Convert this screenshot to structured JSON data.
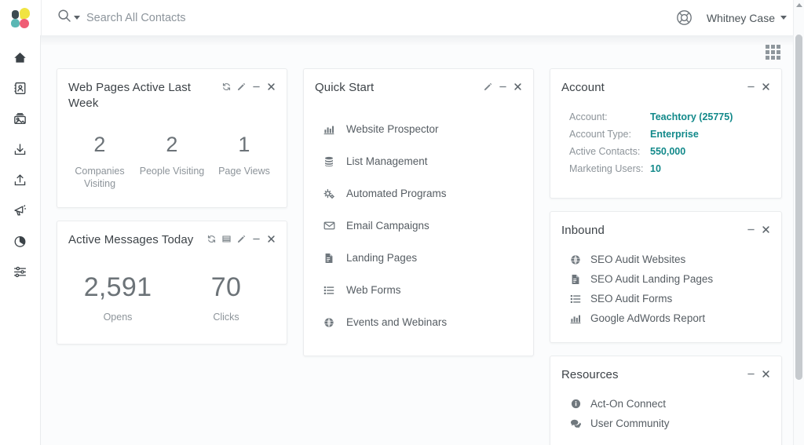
{
  "topbar": {
    "logo_name": "act-on-logo",
    "search": {
      "placeholder": "Search All Contacts",
      "value": "",
      "icon": "search-icon",
      "dropdown_icon": "caret-down-icon"
    },
    "help_icon": "life-ring-help-icon",
    "user": {
      "name": "Whitney Case",
      "caret": "caret-down-icon"
    }
  },
  "sidebar": {
    "items": [
      {
        "icon": "home-icon",
        "label": "Home"
      },
      {
        "icon": "contacts-icon",
        "label": "Contacts"
      },
      {
        "icon": "media-images-icon",
        "label": "Content"
      },
      {
        "icon": "inbound-download-icon",
        "label": "Inbound"
      },
      {
        "icon": "outbound-upload-icon",
        "label": "Outbound"
      },
      {
        "icon": "megaphone-icon",
        "label": "Automated Programs"
      },
      {
        "icon": "pie-chart-icon",
        "label": "Reports"
      },
      {
        "icon": "sliders-settings-icon",
        "label": "Settings"
      }
    ]
  },
  "content": {
    "grid_toggle_icon": "grid-layout-icon"
  },
  "panels": {
    "web_pages": {
      "title": "Web Pages Active Last Week",
      "tools": [
        "refresh-icon",
        "edit-pencil-icon",
        "minimize-icon",
        "close-icon"
      ],
      "stats": [
        {
          "value": "2",
          "label": "Companies Visiting"
        },
        {
          "value": "2",
          "label": "People Visiting"
        },
        {
          "value": "1",
          "label": "Page Views"
        }
      ]
    },
    "active_messages": {
      "title": "Active Messages Today",
      "tools": [
        "refresh-icon",
        "table-view-icon",
        "edit-pencil-icon",
        "minimize-icon",
        "close-icon"
      ],
      "stats": [
        {
          "value": "2,591",
          "label": "Opens"
        },
        {
          "value": "70",
          "label": "Clicks"
        }
      ]
    },
    "quick_start": {
      "title": "Quick Start",
      "tools": [
        "edit-pencil-icon",
        "minimize-icon",
        "close-icon"
      ],
      "items": [
        {
          "icon": "bar-chart-icon",
          "label": "Website Prospector"
        },
        {
          "icon": "database-icon",
          "label": "List Management"
        },
        {
          "icon": "gears-icon",
          "label": "Automated Programs"
        },
        {
          "icon": "envelope-icon",
          "label": "Email Campaigns"
        },
        {
          "icon": "document-icon",
          "label": "Landing Pages"
        },
        {
          "icon": "list-icon",
          "label": "Web Forms"
        },
        {
          "icon": "globe-icon",
          "label": "Events and Webinars"
        }
      ]
    },
    "account": {
      "title": "Account",
      "tools": [
        "minimize-icon",
        "close-icon"
      ],
      "accent_color": "#12898a",
      "rows": [
        {
          "key": "Account:",
          "value": "Teachtory (25775)"
        },
        {
          "key": "Account Type:",
          "value": "Enterprise"
        },
        {
          "key": "Active Contacts:",
          "value": "550,000"
        },
        {
          "key": "Marketing Users:",
          "value": "10"
        }
      ]
    },
    "inbound": {
      "title": "Inbound",
      "tools": [
        "minimize-icon",
        "close-icon"
      ],
      "items": [
        {
          "icon": "globe-icon",
          "label": "SEO Audit Websites"
        },
        {
          "icon": "document-icon",
          "label": "SEO Audit Landing Pages"
        },
        {
          "icon": "list-icon",
          "label": "SEO Audit Forms"
        },
        {
          "icon": "bar-chart-icon",
          "label": "Google AdWords Report"
        }
      ]
    },
    "resources": {
      "title": "Resources",
      "tools": [
        "minimize-icon",
        "close-icon"
      ],
      "items": [
        {
          "icon": "info-circle-icon",
          "label": "Act-On Connect"
        },
        {
          "icon": "chat-bubbles-icon",
          "label": "User Community"
        }
      ]
    }
  }
}
